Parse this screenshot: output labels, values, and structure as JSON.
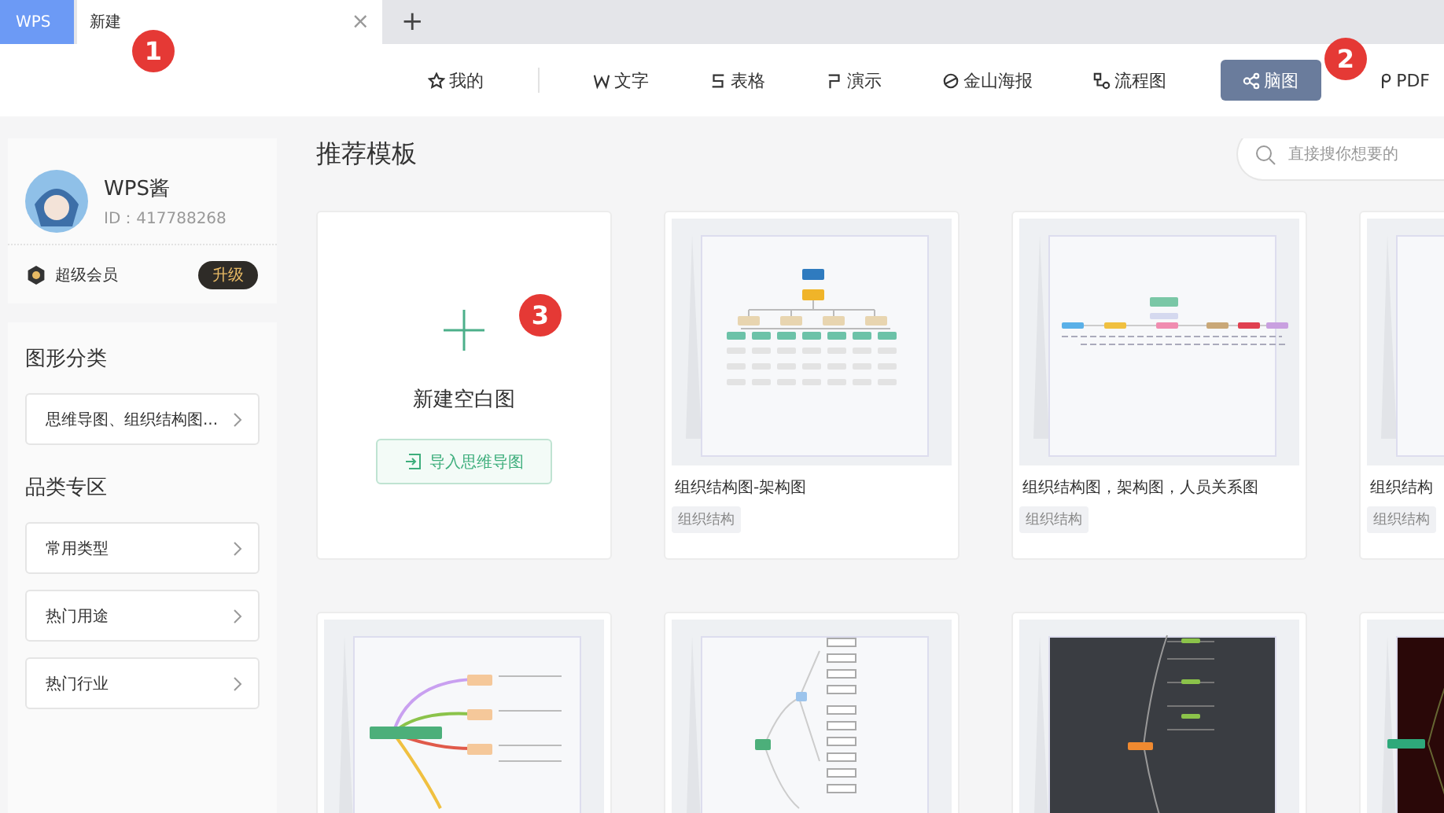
{
  "tabs": [
    {
      "label": "WPS",
      "kind": "brand"
    },
    {
      "label": "新建",
      "kind": "doc",
      "close": "×"
    }
  ],
  "new_tab": "+",
  "nav": [
    {
      "label": "我的",
      "selected": false
    },
    {
      "label": "文字",
      "selected": false
    },
    {
      "label": "表格",
      "selected": false
    },
    {
      "label": "演示",
      "selected": false
    },
    {
      "label": "金山海报",
      "selected": false
    },
    {
      "label": "流程图",
      "selected": false
    },
    {
      "label": "脑图",
      "selected": true
    },
    {
      "label": "PDF",
      "selected": false
    }
  ],
  "profile": {
    "name": "WPS酱",
    "id": "ID：417788268",
    "membership": "超级会员",
    "upgrade": "升级"
  },
  "sidebar": [
    {
      "heading": "图形分类",
      "items": [
        "思维导图、组织结构图..."
      ]
    },
    {
      "heading": "品类专区",
      "items": [
        "常用类型",
        "热门用途",
        "热门行业"
      ]
    }
  ],
  "main": {
    "title": "推荐模板",
    "search": {
      "placeholder": "直接搜你想要的"
    },
    "new_card": {
      "label": "新建空白图",
      "import": "导入思维导图"
    },
    "templates": [
      {
        "kind": "picture",
        "title": "组织结构图-架构图",
        "tag": "组织结构"
      },
      {
        "kind": "picture",
        "title": "组织结构图，架构图，人员关系图",
        "tag": "组织结构"
      },
      {
        "kind": "picture",
        "title": "组织结构",
        "tag": "组织结构"
      },
      {
        "kind": "picture"
      },
      {
        "kind": "picture"
      },
      {
        "kind": "picture"
      },
      {
        "kind": "picture"
      }
    ]
  },
  "annotations": [
    "1",
    "2",
    "3"
  ]
}
